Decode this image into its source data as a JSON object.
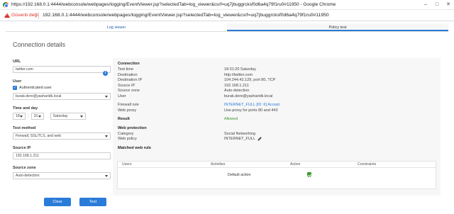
{
  "window": {
    "title": "https://192.168.0.1:4444/webconsole/webpages/logging/EventViewer.jsp?selectedTab=log_viewer&csrf=uq7jbuggrcksf0d6a4q79f1ru0#11950 - Google Chrome"
  },
  "addressbar": {
    "security": "Güvenli değil",
    "url": "192.168.0.1:4444/webconsole/webpages/logging/EventViewer.jsp?selectedTab=log_viewer&csrf=uq7jbuggrcksf0d6a4q79f1ru0#11950"
  },
  "tabs": [
    {
      "label": "Log viewer",
      "active": false
    },
    {
      "label": "Policy test",
      "active": true
    }
  ],
  "form": {
    "heading": "Connection details",
    "url_label": "URL",
    "url_value": "twitter.com",
    "user_label": "User",
    "auth_label": "Authenticated user",
    "user_value": "burak.dere@yasharidk.local",
    "time_label": "Time and day",
    "hour": "18",
    "minute": "31",
    "day": "Saturday",
    "method_label": "Test method",
    "method_value": "Firewall, SSL/TLS, and web",
    "ip_label": "Source IP",
    "ip_value": "192.168.1.211",
    "zone_label": "Source zone",
    "zone_value": "Auto-detection",
    "clear_label": "Clear",
    "test_label": "Test"
  },
  "result": {
    "connection_heading": "Connection",
    "connection": [
      {
        "k": "Test time",
        "v": "18:31:20 Saturday"
      },
      {
        "k": "Destination",
        "v": "http://twitter.com"
      },
      {
        "k": "Destination IP",
        "v": "104.244.42.129, port 80, TCP"
      },
      {
        "k": "Source IP",
        "v": "192.168.1.211"
      },
      {
        "k": "Source zone",
        "v": "Auto-detection"
      },
      {
        "k": "User",
        "v": "burak.dere@yasharidk.local"
      }
    ],
    "firewall_rule_label": "Firewall rule",
    "firewall_rule_value": "INTERNET_FULL [ID: 6] Accept",
    "web_proxy_label": "Web proxy",
    "web_proxy_value": "Use proxy for ports 80 and 443",
    "result_label": "Result",
    "result_value": "Allowed",
    "web_protection_heading": "Web protection",
    "category_label": "Category",
    "category_value": "Social Networking",
    "web_policy_label": "Web policy",
    "web_policy_value": "INTERNET_FULL",
    "matched_rule_heading": "Matched web rule",
    "table": {
      "headers": [
        "Users",
        "Activities",
        "Action",
        "Constraints"
      ],
      "row": {
        "users": "",
        "activities": "Default action",
        "action": "",
        "constraints": ""
      }
    }
  },
  "colors": {
    "accent": "#2b7bd9",
    "allowed": "#3a9a2f",
    "warning": "#d93025"
  }
}
